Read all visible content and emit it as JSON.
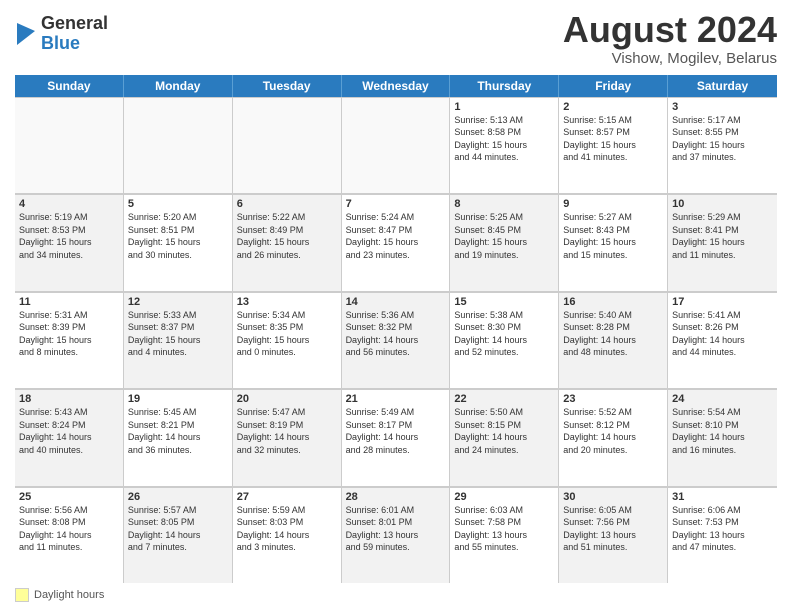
{
  "logo": {
    "general": "General",
    "blue": "Blue"
  },
  "title": "August 2024",
  "subtitle": "Vishow, Mogilev, Belarus",
  "days_of_week": [
    "Sunday",
    "Monday",
    "Tuesday",
    "Wednesday",
    "Thursday",
    "Friday",
    "Saturday"
  ],
  "footer_label": "Daylight hours",
  "weeks": [
    [
      {
        "day": "",
        "info": "",
        "empty": true
      },
      {
        "day": "",
        "info": "",
        "empty": true
      },
      {
        "day": "",
        "info": "",
        "empty": true
      },
      {
        "day": "",
        "info": "",
        "empty": true
      },
      {
        "day": "1",
        "info": "Sunrise: 5:13 AM\nSunset: 8:58 PM\nDaylight: 15 hours\nand 44 minutes."
      },
      {
        "day": "2",
        "info": "Sunrise: 5:15 AM\nSunset: 8:57 PM\nDaylight: 15 hours\nand 41 minutes."
      },
      {
        "day": "3",
        "info": "Sunrise: 5:17 AM\nSunset: 8:55 PM\nDaylight: 15 hours\nand 37 minutes."
      }
    ],
    [
      {
        "day": "4",
        "info": "Sunrise: 5:19 AM\nSunset: 8:53 PM\nDaylight: 15 hours\nand 34 minutes.",
        "shaded": true
      },
      {
        "day": "5",
        "info": "Sunrise: 5:20 AM\nSunset: 8:51 PM\nDaylight: 15 hours\nand 30 minutes."
      },
      {
        "day": "6",
        "info": "Sunrise: 5:22 AM\nSunset: 8:49 PM\nDaylight: 15 hours\nand 26 minutes.",
        "shaded": true
      },
      {
        "day": "7",
        "info": "Sunrise: 5:24 AM\nSunset: 8:47 PM\nDaylight: 15 hours\nand 23 minutes."
      },
      {
        "day": "8",
        "info": "Sunrise: 5:25 AM\nSunset: 8:45 PM\nDaylight: 15 hours\nand 19 minutes.",
        "shaded": true
      },
      {
        "day": "9",
        "info": "Sunrise: 5:27 AM\nSunset: 8:43 PM\nDaylight: 15 hours\nand 15 minutes."
      },
      {
        "day": "10",
        "info": "Sunrise: 5:29 AM\nSunset: 8:41 PM\nDaylight: 15 hours\nand 11 minutes.",
        "shaded": true
      }
    ],
    [
      {
        "day": "11",
        "info": "Sunrise: 5:31 AM\nSunset: 8:39 PM\nDaylight: 15 hours\nand 8 minutes."
      },
      {
        "day": "12",
        "info": "Sunrise: 5:33 AM\nSunset: 8:37 PM\nDaylight: 15 hours\nand 4 minutes.",
        "shaded": true
      },
      {
        "day": "13",
        "info": "Sunrise: 5:34 AM\nSunset: 8:35 PM\nDaylight: 15 hours\nand 0 minutes."
      },
      {
        "day": "14",
        "info": "Sunrise: 5:36 AM\nSunset: 8:32 PM\nDaylight: 14 hours\nand 56 minutes.",
        "shaded": true
      },
      {
        "day": "15",
        "info": "Sunrise: 5:38 AM\nSunset: 8:30 PM\nDaylight: 14 hours\nand 52 minutes."
      },
      {
        "day": "16",
        "info": "Sunrise: 5:40 AM\nSunset: 8:28 PM\nDaylight: 14 hours\nand 48 minutes.",
        "shaded": true
      },
      {
        "day": "17",
        "info": "Sunrise: 5:41 AM\nSunset: 8:26 PM\nDaylight: 14 hours\nand 44 minutes."
      }
    ],
    [
      {
        "day": "18",
        "info": "Sunrise: 5:43 AM\nSunset: 8:24 PM\nDaylight: 14 hours\nand 40 minutes.",
        "shaded": true
      },
      {
        "day": "19",
        "info": "Sunrise: 5:45 AM\nSunset: 8:21 PM\nDaylight: 14 hours\nand 36 minutes."
      },
      {
        "day": "20",
        "info": "Sunrise: 5:47 AM\nSunset: 8:19 PM\nDaylight: 14 hours\nand 32 minutes.",
        "shaded": true
      },
      {
        "day": "21",
        "info": "Sunrise: 5:49 AM\nSunset: 8:17 PM\nDaylight: 14 hours\nand 28 minutes."
      },
      {
        "day": "22",
        "info": "Sunrise: 5:50 AM\nSunset: 8:15 PM\nDaylight: 14 hours\nand 24 minutes.",
        "shaded": true
      },
      {
        "day": "23",
        "info": "Sunrise: 5:52 AM\nSunset: 8:12 PM\nDaylight: 14 hours\nand 20 minutes."
      },
      {
        "day": "24",
        "info": "Sunrise: 5:54 AM\nSunset: 8:10 PM\nDaylight: 14 hours\nand 16 minutes.",
        "shaded": true
      }
    ],
    [
      {
        "day": "25",
        "info": "Sunrise: 5:56 AM\nSunset: 8:08 PM\nDaylight: 14 hours\nand 11 minutes."
      },
      {
        "day": "26",
        "info": "Sunrise: 5:57 AM\nSunset: 8:05 PM\nDaylight: 14 hours\nand 7 minutes.",
        "shaded": true
      },
      {
        "day": "27",
        "info": "Sunrise: 5:59 AM\nSunset: 8:03 PM\nDaylight: 14 hours\nand 3 minutes."
      },
      {
        "day": "28",
        "info": "Sunrise: 6:01 AM\nSunset: 8:01 PM\nDaylight: 13 hours\nand 59 minutes.",
        "shaded": true
      },
      {
        "day": "29",
        "info": "Sunrise: 6:03 AM\nSunset: 7:58 PM\nDaylight: 13 hours\nand 55 minutes."
      },
      {
        "day": "30",
        "info": "Sunrise: 6:05 AM\nSunset: 7:56 PM\nDaylight: 13 hours\nand 51 minutes.",
        "shaded": true
      },
      {
        "day": "31",
        "info": "Sunrise: 6:06 AM\nSunset: 7:53 PM\nDaylight: 13 hours\nand 47 minutes."
      }
    ]
  ]
}
